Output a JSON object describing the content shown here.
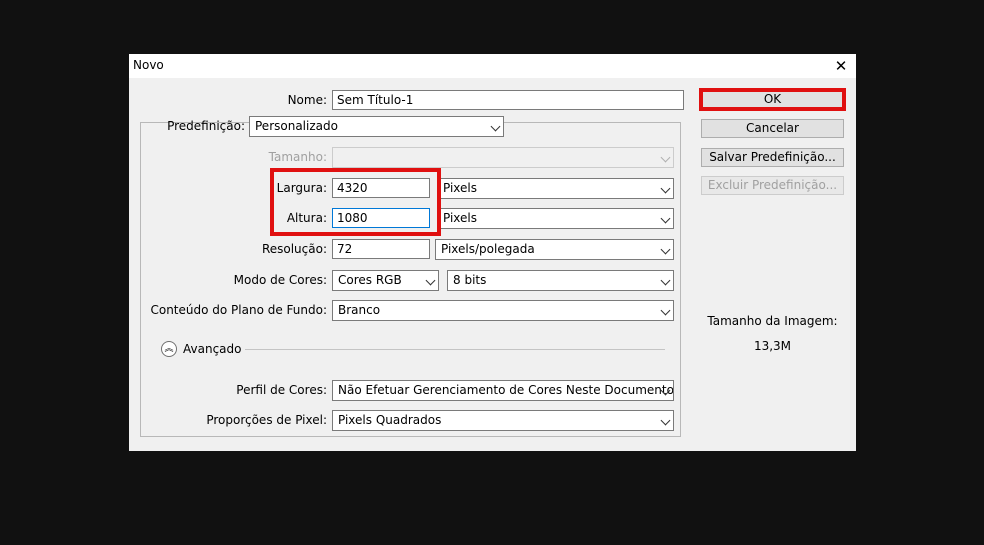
{
  "dialog": {
    "title": "Novo"
  },
  "fields": {
    "nome": {
      "label": "Nome:",
      "value": "Sem Título-1"
    },
    "predefinicao": {
      "label": "Predefinição:",
      "value": "Personalizado"
    },
    "tamanho": {
      "label": "Tamanho:",
      "value": ""
    },
    "largura": {
      "label": "Largura:",
      "value": "4320",
      "unit": "Pixels"
    },
    "altura": {
      "label": "Altura:",
      "value": "1080",
      "unit": "Pixels"
    },
    "resolucao": {
      "label": "Resolução:",
      "value": "72",
      "unit": "Pixels/polegada"
    },
    "modo_cores": {
      "label": "Modo de Cores:",
      "value": "Cores RGB",
      "bits": "8 bits"
    },
    "conteudo_fundo": {
      "label": "Conteúdo do Plano de Fundo:",
      "value": "Branco"
    },
    "avancado": {
      "label": "Avançado"
    },
    "perfil_cores": {
      "label": "Perfil de Cores:",
      "value": "Não Efetuar Gerenciamento de Cores Neste Documento"
    },
    "proporcoes_pixel": {
      "label": "Proporções de Pixel:",
      "value": "Pixels Quadrados"
    }
  },
  "buttons": {
    "ok": "OK",
    "cancelar": "Cancelar",
    "salvar": "Salvar Predefinição...",
    "excluir": "Excluir Predefinição..."
  },
  "image_size": {
    "label": "Tamanho da Imagem:",
    "value": "13,3M"
  },
  "colors": {
    "highlight": "#e01010",
    "dialog_bg": "#f0f0f0",
    "backdrop": "#111111"
  }
}
